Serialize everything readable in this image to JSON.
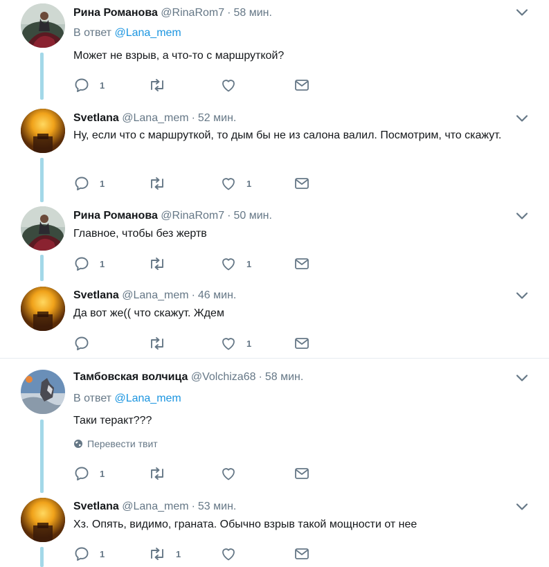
{
  "colors": {
    "accent": "#1b95e0",
    "muted": "#657786",
    "thread_line": "#a3d8e8",
    "text": "#14171a"
  },
  "icons": {
    "reply": "speech-bubble-icon",
    "retweet": "retweet-arrows-icon",
    "like": "heart-icon",
    "dm": "envelope-icon",
    "more": "chevron-down-icon",
    "translate": "globe-icon"
  },
  "tweets": [
    {
      "name": "Рина Романова",
      "handle": "@RinaRom7",
      "time": "58 мин.",
      "reply_prefix": "В ответ",
      "reply_to": "@Lana_mem",
      "text": "Может не взрыв, а что-то с маршруткой?",
      "replies": "1",
      "retweets": "",
      "likes": ""
    },
    {
      "name": "Svetlana",
      "handle": "@Lana_mem",
      "time": "52 мин.",
      "text": "Ну, если что с маршруткой, то дым бы не из салона валил. Посмотрим, что скажут.",
      "replies": "1",
      "retweets": "",
      "likes": "1"
    },
    {
      "name": "Рина Романова",
      "handle": "@RinaRom7",
      "time": "50 мин.",
      "text": "Главное, чтобы без жертв",
      "replies": "1",
      "retweets": "",
      "likes": "1"
    },
    {
      "name": "Svetlana",
      "handle": "@Lana_mem",
      "time": "46 мин.",
      "text": "Да вот же(( что скажут. Ждем",
      "replies": "",
      "retweets": "",
      "likes": "1"
    },
    {
      "name": "Тамбовская волчица",
      "handle": "@Volchiza68",
      "time": "58 мин.",
      "reply_prefix": "В ответ",
      "reply_to": "@Lana_mem",
      "text": "Таки теракт???",
      "translate": "Перевести твит",
      "replies": "1",
      "retweets": "",
      "likes": ""
    },
    {
      "name": "Svetlana",
      "handle": "@Lana_mem",
      "time": "53 мин.",
      "text": "Хз. Опять, видимо, граната. Обычно взрыв такой мощности от нее",
      "replies": "1",
      "retweets": "1",
      "likes": ""
    }
  ]
}
